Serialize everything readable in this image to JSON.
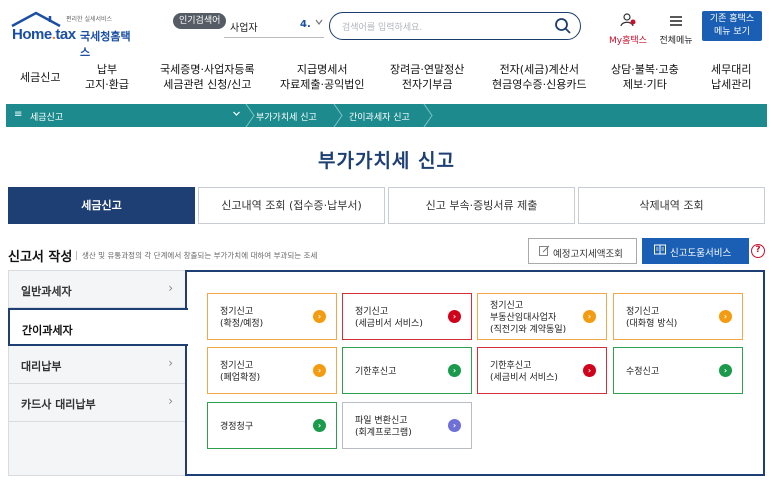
{
  "header": {
    "logo_small": "편리한 실세서비스",
    "logo_brand_a": "Home",
    "logo_brand_dot": ".",
    "logo_brand_b": "tax",
    "logo_kor": "국세청홈택스",
    "popular_label": "인기검색어",
    "popular_keyword": "사업자",
    "popular_rank": "4.",
    "search_placeholder": "검색어를 입력하세요.",
    "myhome_label": "My홈택스",
    "allmenu_label": "전체메뉴",
    "oldmenu_line1": "기존 홈택스",
    "oldmenu_line2": "메뉴 보기"
  },
  "nav": [
    {
      "l1": "세금신고",
      "l2": ""
    },
    {
      "l1": "납부",
      "l2": "고지·환급"
    },
    {
      "l1": "국세증명·사업자등록",
      "l2": "세금관련 신청/신고"
    },
    {
      "l1": "지급명세서",
      "l2": "자료제출·공익법인"
    },
    {
      "l1": "장려금·연말정산",
      "l2": "전자기부금"
    },
    {
      "l1": "전자(세금)계산서",
      "l2": "현금영수증·신용카드"
    },
    {
      "l1": "상담·불복·고충",
      "l2": "제보·기타"
    },
    {
      "l1": "세무대리",
      "l2": "납세관리"
    }
  ],
  "breadcrumb": {
    "root": "세금신고",
    "level2": "부가가치세 신고",
    "level3": "간이과세자 신고"
  },
  "page_title": "부가가치세 신고",
  "tabs": [
    "세금신고",
    "신고내역 조회 (접수증·납부서)",
    "신고 부속·증빙서류 제출",
    "삭제내역 조회"
  ],
  "section": {
    "title": "신고서 작성",
    "desc": "생산 및 유통과정의 각 단계에서 창출되는 부가가치에 대하여 부과되는 조세",
    "btn_estimate": "예정고지세액조회",
    "btn_help_service": "신고도움서비스",
    "help": "?"
  },
  "sidebar": [
    {
      "label": "일반과세자",
      "chev": "›"
    },
    {
      "label": "간이과세자",
      "chev": ""
    },
    {
      "label": "대리납부",
      "chev": "›"
    },
    {
      "label": "카드사 대리납부",
      "chev": "›"
    }
  ],
  "cards": [
    {
      "l1": "정기신고",
      "l2": "(확정/예정)",
      "l3": "",
      "border": "#f0a946",
      "arrow": "#f39c12"
    },
    {
      "l1": "정기신고",
      "l2": "(세금비서 서비스)",
      "l3": "",
      "border": "#d42e3b",
      "arrow": "#d0021b"
    },
    {
      "l1": "정기신고",
      "l2": "부동산임대사업자",
      "l3": "(직전기와 계약동일)",
      "border": "#f0a946",
      "arrow": "#f39c12"
    },
    {
      "l1": "정기신고",
      "l2": "(대화형 방식)",
      "l3": "",
      "border": "#f0a946",
      "arrow": "#f39c12"
    },
    {
      "l1": "정기신고",
      "l2": "(폐업확정)",
      "l3": "",
      "border": "#f0a946",
      "arrow": "#f39c12"
    },
    {
      "l1": "기한후신고",
      "l2": "",
      "l3": "",
      "border": "#2e9e4f",
      "arrow": "#1a9a4a"
    },
    {
      "l1": "기한후신고",
      "l2": "(세금비서 서비스)",
      "l3": "",
      "border": "#d42e3b",
      "arrow": "#d0021b"
    },
    {
      "l1": "수정신고",
      "l2": "",
      "l3": "",
      "border": "#2e9e4f",
      "arrow": "#1a9a4a"
    },
    {
      "l1": "경정청구",
      "l2": "",
      "l3": "",
      "border": "#2e9e4f",
      "arrow": "#1a9a4a"
    },
    {
      "l1": "파일 변환신고",
      "l2": "(회계프로그램)",
      "l3": "",
      "border": "#b8bcc3",
      "arrow": "#6f6fd8"
    }
  ],
  "arrow_glyph": "›"
}
